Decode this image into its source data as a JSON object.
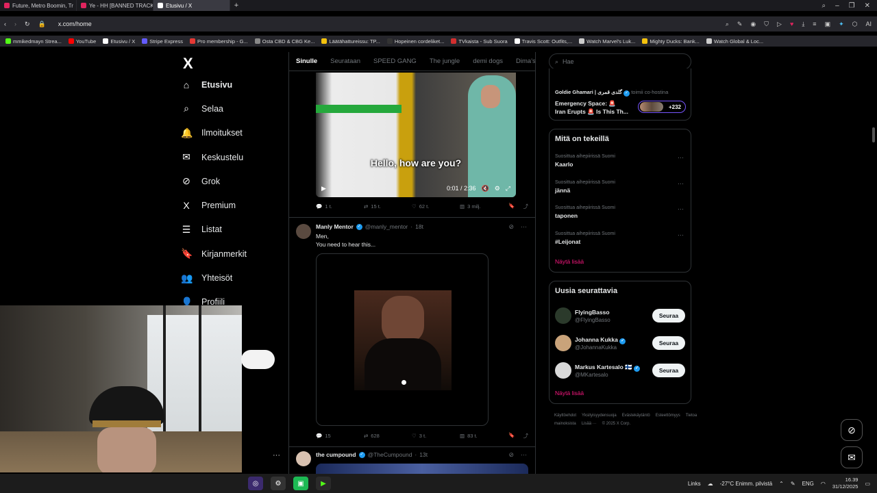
{
  "browser": {
    "tabs": [
      {
        "title": "Future, Metro Boomin, Tr",
        "color": "#e0245e"
      },
      {
        "title": "Ye - HH [BANNED TRACK]",
        "color": "#e0245e"
      },
      {
        "title": "Etusivu / X",
        "color": "#ffffff"
      }
    ],
    "new_tab": "+",
    "url": "x.com/home",
    "bookmarks": [
      {
        "label": "mmikedmayn Strea...",
        "color": "#53fc18"
      },
      {
        "label": "YouTube",
        "color": "#ff0000"
      },
      {
        "label": "Etusivu / X",
        "color": "#ffffff"
      },
      {
        "label": "Stripe Express",
        "color": "#635bff"
      },
      {
        "label": "Pro membership - G...",
        "color": "#e53935"
      },
      {
        "label": "Osta CBD & CBG Ke...",
        "color": "#888888"
      },
      {
        "label": "Läätähattureissu: TP...",
        "color": "#f4c20d"
      },
      {
        "label": "Hopeinen cordeliket...",
        "color": "#333333"
      },
      {
        "label": "TVkaista - Sub Suora",
        "color": "#d32f2f"
      },
      {
        "label": "Travis Scott: Outfits,...",
        "color": "#ffffff"
      },
      {
        "label": "Watch Marvel's Luk...",
        "color": "#cccccc"
      },
      {
        "label": "Mighty Ducks: Bank...",
        "color": "#f4c20d"
      },
      {
        "label": "Watch Global & Loc...",
        "color": "#cccccc"
      }
    ]
  },
  "nav": {
    "logo": "X",
    "items": [
      {
        "label": "Etusivu",
        "icon": "⌂"
      },
      {
        "label": "Selaa",
        "icon": "⌕"
      },
      {
        "label": "Ilmoitukset",
        "icon": "🔔"
      },
      {
        "label": "Keskustelu",
        "icon": "✉"
      },
      {
        "label": "Grok",
        "icon": "⊘"
      },
      {
        "label": "Premium",
        "icon": "X"
      },
      {
        "label": "Listat",
        "icon": "☰"
      },
      {
        "label": "Kirjanmerkit",
        "icon": "🔖"
      },
      {
        "label": "Yhteisöt",
        "icon": "👥"
      },
      {
        "label": "Profiili",
        "icon": "👤"
      }
    ],
    "more": "···"
  },
  "timeline": {
    "tabs": [
      "Sinulle",
      "Seurataan",
      "SPEED GANG",
      "The jungle",
      "demi dogs",
      "Dima's Di"
    ],
    "post1": {
      "subtitle": "Hello, how are you?",
      "time": "0:01 / 2:36",
      "replies": "1 t.",
      "reposts": "15 t.",
      "likes": "62 t.",
      "views": "3 milj."
    },
    "post2": {
      "name": "Manly Mentor",
      "handle": "@manly_mentor",
      "age": "18t",
      "text1": "Men,",
      "text2": "You need to hear this...",
      "replies": "15",
      "reposts": "628",
      "likes": "3 t.",
      "views": "83 t."
    },
    "post3": {
      "name": "the cumpound",
      "handle": "@TheCumpound",
      "age": "13t"
    }
  },
  "sidebar": {
    "search_placeholder": "Hae",
    "space": {
      "host_name": "Goldie Ghamari | گلدی قمری",
      "host_role": "toimii co-hostina",
      "title_line1": "Emergency Space: 🚨",
      "title_line2": "Iran Erupts 🚨 Is This Th...",
      "count": "+232"
    },
    "trends_title": "Mitä on tekeillä",
    "trends": [
      {
        "context": "Suosittua aihepiirissä Suomi",
        "topic": "Kaarlo"
      },
      {
        "context": "Suosittua aihepiirissä Suomi",
        "topic": "jännä"
      },
      {
        "context": "Suosittua aihepiirissä Suomi",
        "topic": "taponen"
      },
      {
        "context": "Suosittua aihepiirissä Suomi",
        "topic": "#Leijonat"
      }
    ],
    "show_more": "Näytä lisää",
    "follow_title": "Uusia seurattavia",
    "follow": [
      {
        "name": "FlyingBasso",
        "handle": "@FlyingBasso",
        "verified": false,
        "color": "#2b3a2b"
      },
      {
        "name": "Johanna Kukka",
        "handle": "@JohannaKukka",
        "verified": true,
        "color": "#c9a37a"
      },
      {
        "name": "Markus Kartesalo 🇫🇮",
        "handle": "@MKartesalo",
        "verified": true,
        "color": "#d9d9d9"
      }
    ],
    "follow_button": "Seuraa",
    "footer": [
      "Käyttöehdot",
      "Yksityisyydensuoja",
      "Evästekäytäntö",
      "Esteettömyys",
      "Tietoa mainoksista",
      "Lisää ···",
      "© 2025 X Corp."
    ]
  },
  "taskbar": {
    "links": "Links",
    "weather": "-27°C  Enimm. pilvistä",
    "lang": "ENG",
    "time": "16.39",
    "date": "31/12/2025"
  }
}
